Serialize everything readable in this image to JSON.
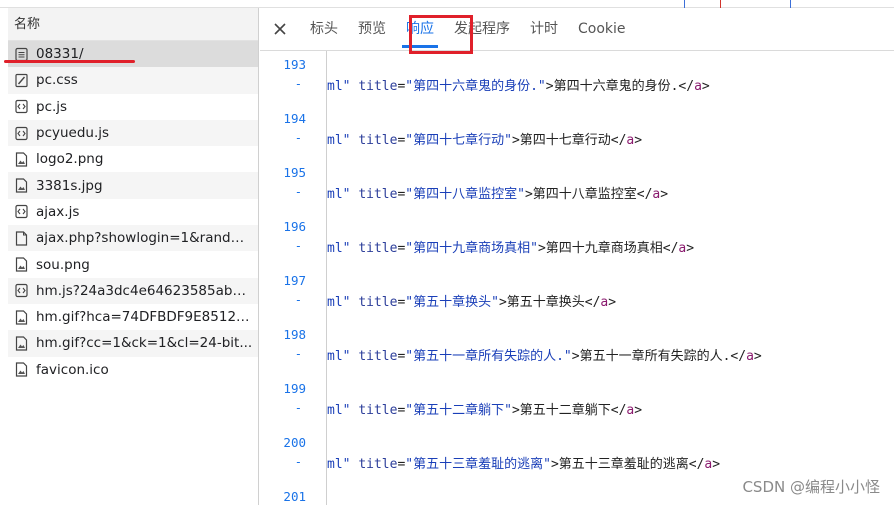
{
  "sidebar": {
    "header": "名称",
    "items": [
      {
        "name": "08331/",
        "icon": "document-icon"
      },
      {
        "name": "pc.css",
        "icon": "css-icon"
      },
      {
        "name": "pc.js",
        "icon": "script-icon"
      },
      {
        "name": "pcyuedu.js",
        "icon": "script-icon"
      },
      {
        "name": "logo2.png",
        "icon": "image-file-icon"
      },
      {
        "name": "3381s.jpg",
        "icon": "image-file-icon"
      },
      {
        "name": "ajax.js",
        "icon": "script-icon"
      },
      {
        "name": "ajax.php?showlogin=1&rand=...",
        "icon": "file-icon"
      },
      {
        "name": "sou.png",
        "icon": "image-file-icon"
      },
      {
        "name": "hm.js?24a3dc4e64623585ab7f...",
        "icon": "script-icon"
      },
      {
        "name": "hm.gif?hca=74DFBDF9E85129...",
        "icon": "image-file-icon"
      },
      {
        "name": "hm.gif?cc=1&ck=1&cl=24-bit...",
        "icon": "image-file-icon"
      },
      {
        "name": "favicon.ico",
        "icon": "image-file-icon"
      }
    ]
  },
  "tabs": {
    "close_label": "close-icon",
    "items": [
      "标头",
      "预览",
      "响应",
      "发起程序",
      "计时",
      "Cookie"
    ],
    "active": "响应"
  },
  "code": {
    "lines": [
      {
        "num": "193",
        "dash": "-",
        "prefix": "ml\"",
        "attr": "title",
        "value": "\"第四十六章鬼的身份.\"",
        "text": "第四十六章鬼的身份.",
        "close": "a"
      },
      {
        "num": "194",
        "dash": "-",
        "prefix": "ml\"",
        "attr": "title",
        "value": "\"第四十七章行动\"",
        "text": "第四十七章行动",
        "close": "a"
      },
      {
        "num": "195",
        "dash": "-",
        "prefix": "ml\"",
        "attr": "title",
        "value": "\"第四十八章监控室\"",
        "text": "第四十八章监控室",
        "close": "a"
      },
      {
        "num": "196",
        "dash": "-",
        "prefix": "ml\"",
        "attr": "title",
        "value": "\"第四十九章商场真相\"",
        "text": "第四十九章商场真相",
        "close": "a"
      },
      {
        "num": "197",
        "dash": "-",
        "prefix": "ml\"",
        "attr": "title",
        "value": "\"第五十章换头\"",
        "text": "第五十章换头",
        "close": "a"
      },
      {
        "num": "198",
        "dash": "-",
        "prefix": "ml\"",
        "attr": "title",
        "value": "\"第五十一章所有失踪的人.\"",
        "text": "第五十一章所有失踪的人.",
        "close": "a"
      },
      {
        "num": "199",
        "dash": "-",
        "prefix": "ml\"",
        "attr": "title",
        "value": "\"第五十二章躺下\"",
        "text": "第五十二章躺下",
        "close": "a"
      },
      {
        "num": "200",
        "dash": "-",
        "prefix": "ml\"",
        "attr": "title",
        "value": "\"第五十三章羞耻的逃离\"",
        "text": "第五十三章羞耻的逃离",
        "close": "a"
      },
      {
        "num": "201",
        "dash": "",
        "prefix": "",
        "attr": "",
        "value": "",
        "text": "",
        "close": ""
      }
    ]
  },
  "watermark": "CSDN @编程小小怪",
  "colors": {
    "accent": "#1a73e8",
    "highlight_red": "#e0202a"
  }
}
